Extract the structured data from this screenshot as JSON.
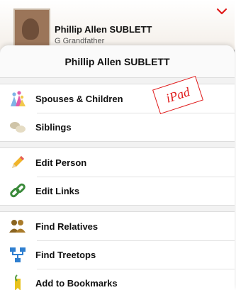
{
  "background": {
    "person_name": "Phillip Allen SUBLETT",
    "relationship": "G Grandfather"
  },
  "sheet": {
    "title": "Phillip Allen SUBLETT",
    "groups": [
      [
        {
          "label": "Spouses & Children",
          "icon": "family-icon"
        },
        {
          "label": "Siblings",
          "icon": "siblings-icon"
        }
      ],
      [
        {
          "label": "Edit Person",
          "icon": "pencil-icon"
        },
        {
          "label": "Edit Links",
          "icon": "link-icon"
        }
      ],
      [
        {
          "label": "Find Relatives",
          "icon": "relatives-icon"
        },
        {
          "label": "Find Treetops",
          "icon": "treetops-icon"
        },
        {
          "label": "Add to Bookmarks",
          "icon": "bookmark-icon"
        }
      ]
    ]
  },
  "stamp": "iPad",
  "colors": {
    "accent_red": "#e01b1b"
  }
}
